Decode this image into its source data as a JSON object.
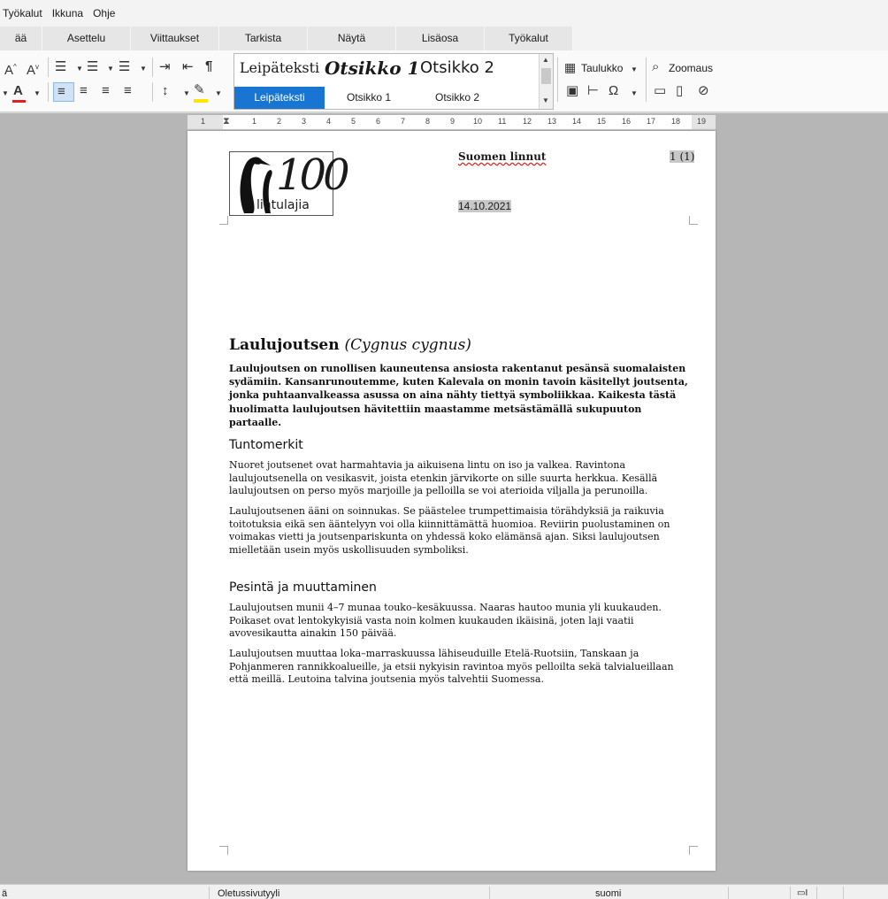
{
  "menubar": {
    "items": [
      "Työkalut",
      "Ikkuna",
      "Ohje"
    ]
  },
  "tabs": {
    "items": [
      "ää",
      "Asettelu",
      "Viittaukset",
      "Tarkista",
      "Näytä",
      "Lisäosa",
      "Työkalut"
    ]
  },
  "toolbar": {
    "styles": [
      {
        "preview": "Leipäteksti",
        "label": "Leipäteksti",
        "selected": true
      },
      {
        "preview": "Otsikko 1",
        "label": "Otsikko 1",
        "selected": false
      },
      {
        "preview": "Otsikko 2",
        "label": "Otsikko 2",
        "selected": false
      }
    ],
    "table_label": "Taulukko",
    "zoom_label": "Zoomaus",
    "accent_color": "#1876d2",
    "font_color_bar": "#e02020",
    "highlight_color_bar": "#ffe600"
  },
  "ruler": {
    "numbers": [
      "1",
      "1",
      "2",
      "3",
      "4",
      "5",
      "6",
      "7",
      "8",
      "9",
      "10",
      "11",
      "12",
      "13",
      "14",
      "15",
      "16",
      "17",
      "18",
      "19"
    ]
  },
  "document": {
    "header": {
      "logo_digits": "100",
      "logo_text": "lintulajia",
      "title": "Suomen linnut",
      "page": "1 (1)",
      "date": "14.10.2021"
    },
    "title": "Laulujoutsen",
    "title_latin": "(Cygnus cygnus)",
    "intro": "Laulujoutsen on runollisen kauneutensa ansiosta rakentanut pesänsä suomalaisten sydämiin. Kansanrunoutemme, kuten Kalevala on monin tavoin käsitellyt joutsenta, jonka puhtaanvalkeassa asussa on aina nähty tiettyä symboliikkaa. Kaikesta tästä huolimatta laulujoutsen hävitettiin maastamme metsästämällä sukupuuton partaalle.",
    "section1_heading": "Tuntomerkit",
    "section1_p1": "Nuoret joutsenet ovat harmahtavia ja aikuisena lintu on iso ja valkea. Ravintona laulujoutsenella on vesikasvit, joista etenkin järvikorte on sille suurta herkkua. Kesällä laulujoutsen on perso myös marjoille ja pelloilla se voi aterioida viljalla ja perunoilla.",
    "section1_p2": "Laulujoutsenen ääni on soinnukas. Se päästelee trumpettimaisia törähdyksiä ja raikuvia toitotuksia eikä sen ääntelyyn voi olla kiinnittämättä huomioa. Reviirin puolustaminen on voimakas vietti ja joutsenpariskunta on yhdessä koko elämänsä ajan. Siksi laulujoutsen mielletään usein myös uskollisuuden symboliksi.",
    "section2_heading": "Pesintä ja muuttaminen",
    "section2_p1": "Laulujoutsen munii 4–7 munaa touko–kesäkuussa. Naaras hautoo munia yli kuukauden. Poikaset ovat lentokykyisiä vasta noin kolmen kuukauden ikäisinä, joten laji vaatii avovesikautta ainakin 150 päivää.",
    "section2_p2": "Laulujoutsen muuttaa loka–marraskuussa lähiseuduille Etelä-Ruotsiin, Tanskaan ja Pohjanmeren rannikkoalueille, ja etsii nykyisin ravintoa myös pelloilta sekä talvialueillaan että meillä. Leutoina talvina joutsenia myös talvehtii Suomessa."
  },
  "statusbar": {
    "left": "ä",
    "page_style": "Oletussivutyyli",
    "language": "suomi"
  }
}
